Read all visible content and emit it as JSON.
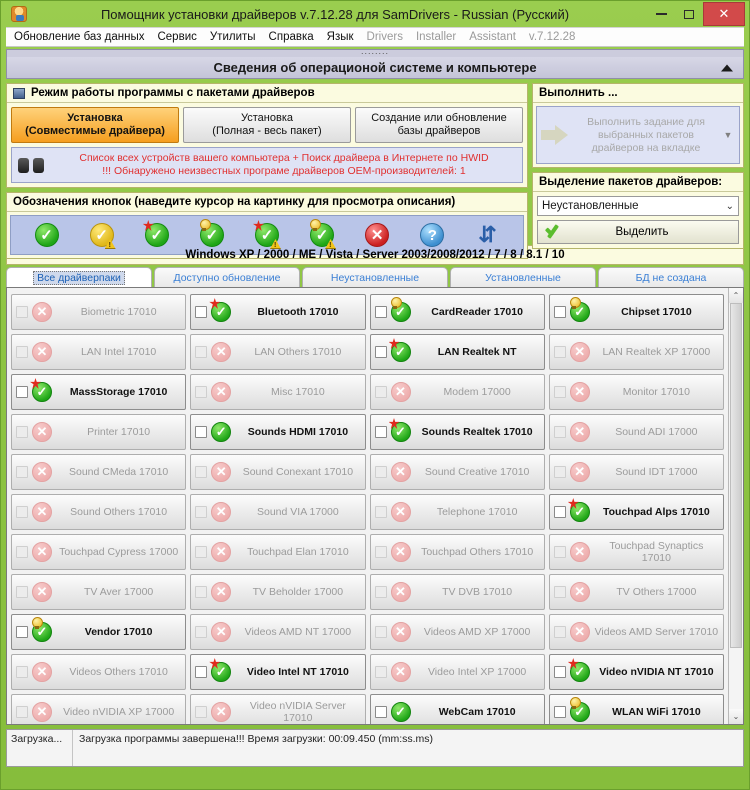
{
  "window": {
    "title": "Помощник установки драйверов v.7.12.28 для SamDrivers - Russian (Русский)",
    "app_icon": "app-icon",
    "minimize_label": "",
    "maximize_label": "",
    "close_label": "✕"
  },
  "menu": {
    "items": [
      {
        "label": "Обновление баз данных",
        "enabled": true
      },
      {
        "label": "Сервис",
        "enabled": true
      },
      {
        "label": "Утилиты",
        "enabled": true
      },
      {
        "label": "Справка",
        "enabled": true
      },
      {
        "label": "Язык",
        "enabled": true
      },
      {
        "label": "Drivers",
        "enabled": false
      },
      {
        "label": "Installer",
        "enabled": false
      },
      {
        "label": "Assistant",
        "enabled": false
      },
      {
        "label": "v.7.12.28",
        "enabled": false
      }
    ]
  },
  "collapse_bar": {
    "title": "Сведения об операционой системе и компьютере",
    "arrow": "▲"
  },
  "mode_panel": {
    "header": "Режим работы программы с пакетами драйверов",
    "buttons": [
      {
        "line1": "Установка",
        "line2": "(Совместимые драйвера)",
        "active": true
      },
      {
        "line1": "Установка",
        "line2": "(Полная - весь пакет)",
        "active": false
      },
      {
        "line1": "Создание или обновление",
        "line2": "базы драйверов",
        "active": false
      }
    ],
    "notice_line1": "Список всех устройств вашего компьютера + Поиск драйвера в Интернете по HWID",
    "notice_line2": "!!! Обнаружено неизвестных програме драйверов OEM-производителей: 1"
  },
  "legend_panel": {
    "header": "Обозначения кнопок (наведите курсор на картинку для просмотра описания)",
    "icons": [
      {
        "name": "green-check-icon",
        "type": "green"
      },
      {
        "name": "yellow-check-warning-icon",
        "type": "yellow-warn"
      },
      {
        "name": "green-check-star-icon",
        "type": "green-star"
      },
      {
        "name": "green-check-bulb-icon",
        "type": "green-bulb"
      },
      {
        "name": "green-check-star-warning-icon",
        "type": "green-star-warn"
      },
      {
        "name": "green-check-bulb-warning-icon",
        "type": "green-bulb-warn"
      },
      {
        "name": "red-cross-icon",
        "type": "red"
      },
      {
        "name": "blue-question-icon",
        "type": "blue"
      },
      {
        "name": "refresh-arrows-icon",
        "type": "refresh"
      }
    ]
  },
  "execute_panel": {
    "header": "Выполнить ...",
    "button_line1": "Выполнить задание для",
    "button_line2": "выбранных пакетов",
    "button_line3": "драйверов на вкладке",
    "dropdown_caret": "▼"
  },
  "selection_panel": {
    "header": "Выделение пакетов драйверов:",
    "combo_value": "Неустановленные",
    "combo_caret": "⌄",
    "select_button": "Выделить"
  },
  "tabs_panel": {
    "os_line": "Windows XP / 2000 / ME / Vista / Server 2003/2008/2012 / 7 / 8 / 8.1 / 10",
    "tabs": [
      {
        "label": "Все драйверпаки",
        "active": true
      },
      {
        "label": "Доступно обновление",
        "active": false
      },
      {
        "label": "Неустановленные",
        "active": false
      },
      {
        "label": "Установленные",
        "active": false
      },
      {
        "label": "БД не создана",
        "active": false
      }
    ]
  },
  "packages": [
    {
      "label": "Biometric 17010",
      "state": "off",
      "badge": "none"
    },
    {
      "label": "Bluetooth 17010",
      "state": "on",
      "badge": "star"
    },
    {
      "label": "CardReader 17010",
      "state": "on",
      "badge": "bulb"
    },
    {
      "label": "Chipset 17010",
      "state": "on",
      "badge": "bulb"
    },
    {
      "label": "LAN Intel 17010",
      "state": "off",
      "badge": "none"
    },
    {
      "label": "LAN Others 17010",
      "state": "off",
      "badge": "none"
    },
    {
      "label": "LAN Realtek NT",
      "state": "on",
      "badge": "star"
    },
    {
      "label": "LAN Realtek XP 17000",
      "state": "off",
      "badge": "none"
    },
    {
      "label": "MassStorage 17010",
      "state": "on",
      "badge": "star"
    },
    {
      "label": "Misc 17010",
      "state": "off",
      "badge": "none"
    },
    {
      "label": "Modem 17000",
      "state": "off",
      "badge": "none"
    },
    {
      "label": "Monitor 17010",
      "state": "off",
      "badge": "none"
    },
    {
      "label": "Printer 17010",
      "state": "off",
      "badge": "none"
    },
    {
      "label": "Sounds HDMI 17010",
      "state": "on",
      "badge": "none"
    },
    {
      "label": "Sounds Realtek 17010",
      "state": "on",
      "badge": "star"
    },
    {
      "label": "Sound ADI 17000",
      "state": "off",
      "badge": "none"
    },
    {
      "label": "Sound CMeda 17010",
      "state": "off",
      "badge": "none"
    },
    {
      "label": "Sound Conexant 17010",
      "state": "off",
      "badge": "none"
    },
    {
      "label": "Sound Creative 17010",
      "state": "off",
      "badge": "none"
    },
    {
      "label": "Sound IDT 17000",
      "state": "off",
      "badge": "none"
    },
    {
      "label": "Sound Others 17010",
      "state": "off",
      "badge": "none"
    },
    {
      "label": "Sound VIA 17000",
      "state": "off",
      "badge": "none"
    },
    {
      "label": "Telephone 17010",
      "state": "off",
      "badge": "none"
    },
    {
      "label": "Touchpad Alps 17010",
      "state": "on",
      "badge": "star"
    },
    {
      "label": "Touchpad Cypress 17000",
      "state": "off",
      "badge": "none"
    },
    {
      "label": "Touchpad Elan 17010",
      "state": "off",
      "badge": "none"
    },
    {
      "label": "Touchpad Others 17010",
      "state": "off",
      "badge": "none"
    },
    {
      "label": "Touchpad Synaptics 17010",
      "state": "off",
      "badge": "none"
    },
    {
      "label": "TV Aver 17000",
      "state": "off",
      "badge": "none"
    },
    {
      "label": "TV Beholder 17000",
      "state": "off",
      "badge": "none"
    },
    {
      "label": "TV DVB 17010",
      "state": "off",
      "badge": "none"
    },
    {
      "label": "TV Others 17000",
      "state": "off",
      "badge": "none"
    },
    {
      "label": "Vendor 17010",
      "state": "on",
      "badge": "bulb"
    },
    {
      "label": "Videos AMD NT 17000",
      "state": "off",
      "badge": "none"
    },
    {
      "label": "Videos AMD XP 17000",
      "state": "off",
      "badge": "none"
    },
    {
      "label": "Videos AMD Server 17010",
      "state": "off",
      "badge": "none"
    },
    {
      "label": "Videos Others 17010",
      "state": "off",
      "badge": "none"
    },
    {
      "label": "Video Intel NT 17010",
      "state": "on",
      "badge": "star"
    },
    {
      "label": "Video Intel XP 17000",
      "state": "off",
      "badge": "none"
    },
    {
      "label": "Video nVIDIA NT 17010",
      "state": "on",
      "badge": "star"
    },
    {
      "label": "Video nVIDIA XP 17000",
      "state": "off",
      "badge": "none"
    },
    {
      "label": "Video nVIDIA Server 17010",
      "state": "off",
      "badge": "none"
    },
    {
      "label": "WebCam 17010",
      "state": "on",
      "badge": "none"
    },
    {
      "label": "WLAN WiFi 17010",
      "state": "on",
      "badge": "bulb"
    }
  ],
  "scrollbar": {
    "up": "⌃",
    "down": "⌄"
  },
  "status_bar": {
    "left": "Загрузка...",
    "right": "Загрузка программы завершена!!! Время загрузки: 00:09.450 (mm:ss.ms)"
  },
  "colors": {
    "window_chrome": "#8cc63f",
    "close_button": "#d24a4a",
    "active_mode": "#f59e1f",
    "notice_text": "#e03030",
    "tab_text": "#3a7fd5",
    "panel_yellow": "#fbfbe0",
    "panel_blue": "#dfe3f5",
    "legend_blue": "#b9c5e8"
  }
}
